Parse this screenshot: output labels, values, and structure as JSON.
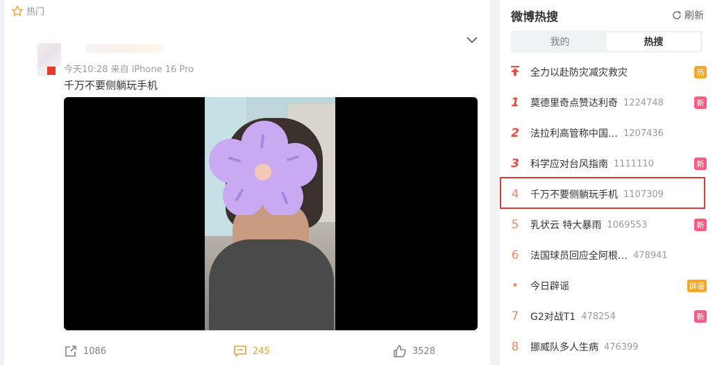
{
  "post": {
    "hot_label": "热门",
    "meta": "今天10:28 来自 iPhone 16 Pro",
    "text": "千万不要侧躺玩手机",
    "actions": {
      "share_count": "1086",
      "comment_count": "245",
      "like_count": "3528"
    }
  },
  "sidebar": {
    "title": "微博热搜",
    "refresh_label": "刷新",
    "tabs": [
      {
        "label": "我的",
        "active": false
      },
      {
        "label": "热搜",
        "active": true
      }
    ],
    "items": [
      {
        "rank": "",
        "title": "全力以赴防灾减灾救灾",
        "count": "",
        "badge": "热"
      },
      {
        "rank": "1",
        "title": "莫德里奇点赞达利奇",
        "count": "1224748",
        "badge": "新"
      },
      {
        "rank": "2",
        "title": "法拉利高管称中国…",
        "count": "1207436",
        "badge": ""
      },
      {
        "rank": "3",
        "title": "科学应对台风指南",
        "count": "1111110",
        "badge": "新"
      },
      {
        "rank": "4",
        "title": "千万不要侧躺玩手机",
        "count": "1107309",
        "badge": ""
      },
      {
        "rank": "5",
        "title": "乳状云 特大暴雨",
        "count": "1069553",
        "badge": "新"
      },
      {
        "rank": "6",
        "title": "法国球员回应全阿根…",
        "count": "478941",
        "badge": ""
      },
      {
        "rank": "•",
        "title": "今日辟谣",
        "count": "",
        "badge": "辟谣"
      },
      {
        "rank": "7",
        "title": "G2对战T1",
        "count": "478254",
        "badge": "新"
      },
      {
        "rank": "8",
        "title": "挪威队多人生病",
        "count": "476399",
        "badge": ""
      }
    ]
  },
  "colors": {
    "accent_red": "#e0392f",
    "hot_badge": "#f6a623",
    "new_badge": "#ff5a84"
  }
}
